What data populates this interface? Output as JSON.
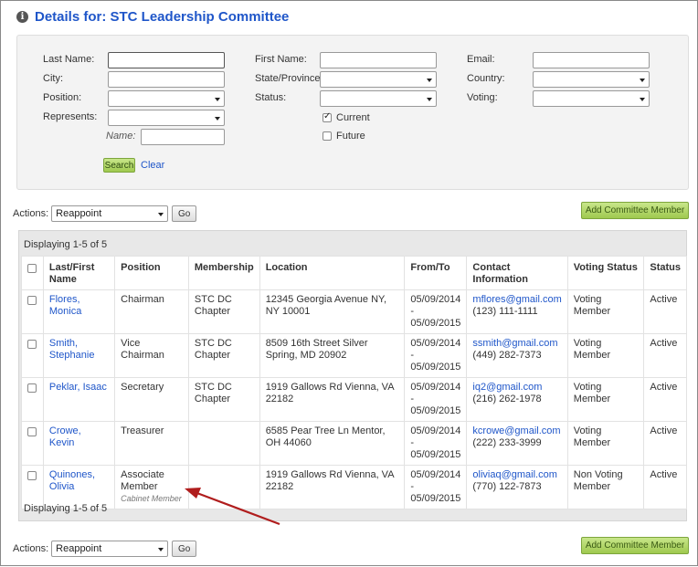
{
  "header": {
    "title": "Details for: STC Leadership Committee"
  },
  "search": {
    "last_name_label": "Last Name:",
    "first_name_label": "First Name:",
    "email_label": "Email:",
    "city_label": "City:",
    "state_label": "State/Province:",
    "country_label": "Country:",
    "position_label": "Position:",
    "status_label": "Status:",
    "voting_label": "Voting:",
    "represents_label": "Represents:",
    "name_label": "Name:",
    "current_label": "Current",
    "future_label": "Future",
    "current_checked": true,
    "future_checked": false,
    "search_button": "Search",
    "clear_link": "Clear"
  },
  "actions": {
    "label": "Actions:",
    "selected": "Reappoint",
    "go_button": "Go",
    "add_button": "Add Committee Member"
  },
  "grid": {
    "displaying_text": "Displaying 1-5 of 5",
    "columns": [
      "Last/First Name",
      "Position",
      "Membership",
      "Location",
      "From/To",
      "Contact Information",
      "Voting Status",
      "Status"
    ],
    "rows": [
      {
        "name": "Flores, Monica",
        "position": "Chairman",
        "position_sub": "",
        "membership": "STC DC Chapter",
        "location": "12345 Georgia Avenue NY, NY 10001",
        "from": "05/09/2014",
        "sep": "-",
        "to": "05/09/2015",
        "email": "mflores@gmail.com",
        "phone": "(123) 111-1111",
        "voting": "Voting Member",
        "status": "Active"
      },
      {
        "name": "Smith, Stephanie",
        "position": "Vice Chairman",
        "position_sub": "",
        "membership": "STC DC Chapter",
        "location": "8509 16th Street Silver Spring, MD 20902",
        "from": "05/09/2014",
        "sep": "-",
        "to": "05/09/2015",
        "email": "ssmith@gmail.com",
        "phone": "(449) 282-7373",
        "voting": "Voting Member",
        "status": "Active"
      },
      {
        "name": "Peklar, Isaac",
        "position": "Secretary",
        "position_sub": "",
        "membership": "STC DC Chapter",
        "location": "1919 Gallows Rd Vienna, VA 22182",
        "from": "05/09/2014",
        "sep": "-",
        "to": "05/09/2015",
        "email": "iq2@gmail.com",
        "phone": "(216) 262-1978",
        "voting": "Voting Member",
        "status": "Active"
      },
      {
        "name": "Crowe, Kevin",
        "position": "Treasurer",
        "position_sub": "",
        "membership": "",
        "location": "6585 Pear Tree Ln Mentor, OH 44060",
        "from": "05/09/2014",
        "sep": "-",
        "to": "05/09/2015",
        "email": "kcrowe@gmail.com",
        "phone": "(222) 233-3999",
        "voting": "Voting Member",
        "status": "Active"
      },
      {
        "name": "Quinones, Olivia",
        "position": "Associate Member",
        "position_sub": "Cabinet Member",
        "membership": "",
        "location": "1919 Gallows Rd Vienna, VA 22182",
        "from": "05/09/2014",
        "sep": "-",
        "to": "05/09/2015",
        "email": "oliviaq@gmail.com",
        "phone": "(770) 122-7873",
        "voting": "Non Voting Member",
        "status": "Active"
      }
    ]
  },
  "colors": {
    "link": "#1f56c9",
    "button_green": "#9fc94f",
    "annotation_arrow": "#b01d1d"
  },
  "icons": {
    "title_icon": "info-icon",
    "annotation": "red-arrow-annotation"
  }
}
